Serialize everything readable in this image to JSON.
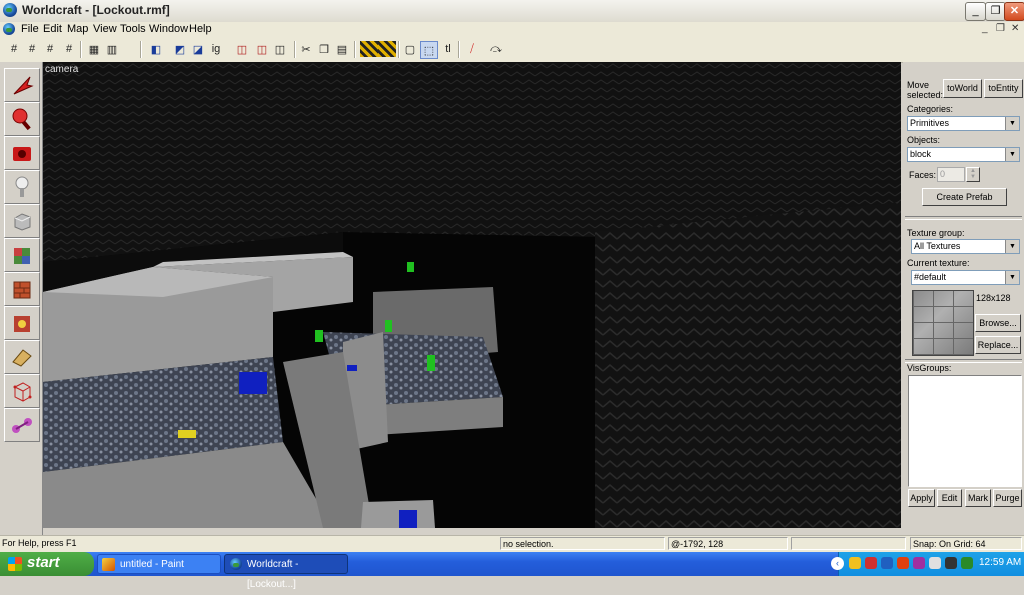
{
  "window": {
    "title": "Worldcraft - [Lockout.rmf]",
    "min_label": "_",
    "max_label": "❐",
    "close_label": "✕"
  },
  "menu": [
    "File",
    "Edit",
    "Map",
    "View",
    "Tools",
    "Window",
    "Help"
  ],
  "mdi_controls": [
    "_",
    "❐",
    "✕"
  ],
  "toolbar_glyphs": [
    "ig",
    "tl"
  ],
  "viewport": {
    "label": "camera"
  },
  "right_panel": {
    "move_selected_label": "Move selected:",
    "to_world": "toWorld",
    "to_entity": "toEntity",
    "categories_label": "Categories:",
    "categories_value": "Primitives",
    "objects_label": "Objects:",
    "objects_value": "block",
    "faces_label": "Faces:",
    "faces_value": "0",
    "create_prefab": "Create Prefab",
    "texture_group_label": "Texture group:",
    "texture_group_value": "All Textures",
    "current_texture_label": "Current texture:",
    "current_texture_value": "#default",
    "texture_size": "128x128",
    "browse": "Browse...",
    "replace": "Replace...",
    "visgroups_label": "VisGroups:",
    "apply": "Apply",
    "edit": "Edit",
    "mark": "Mark",
    "purge": "Purge"
  },
  "status": {
    "help": "For Help, press F1",
    "selection": "no selection.",
    "coords": "@-1792, 128",
    "snap": "Snap: On Grid: 64"
  },
  "taskbar": {
    "start": "start",
    "tasks": [
      "untitled - Paint",
      "Worldcraft - [Lockout...]"
    ],
    "clock": "12:59 AM"
  }
}
